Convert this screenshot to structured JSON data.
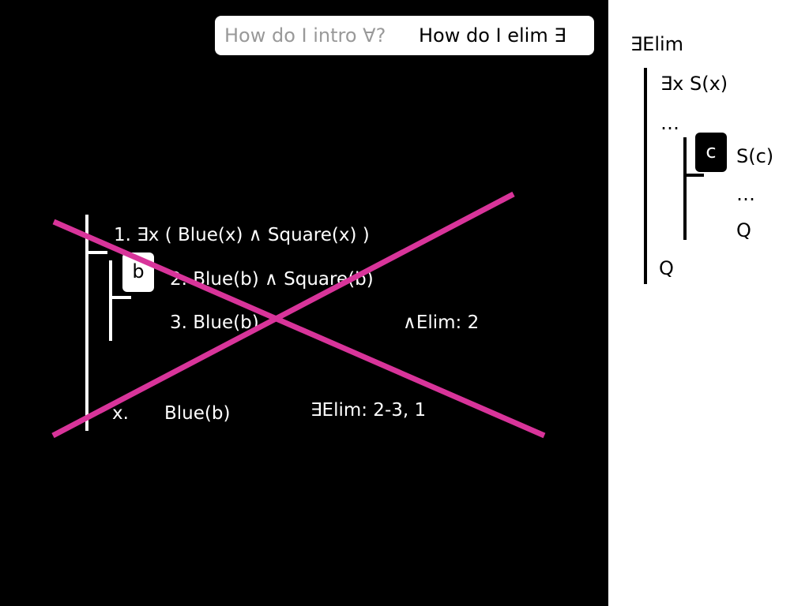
{
  "topbar": {
    "intro_question": "How do I intro ∀?",
    "elim_question": "How do I elim ∃"
  },
  "proof": {
    "line1": "1. ∃x ( Blue(x) ∧ Square(x) )",
    "subproof_constant": "b",
    "line2": "2. Blue(b) ∧ Square(b)",
    "line3": "3. Blue(b)",
    "line3_rule": "∧Elim: 2",
    "conclusion_number": "x.",
    "conclusion": "Blue(b)",
    "conclusion_rule": "∃Elim: 2-3, 1"
  },
  "schema": {
    "title": "∃Elim",
    "premise": "∃x S(x)",
    "dots_outer": "…",
    "constant": "c",
    "sub_assumption": "S(c)",
    "dots_inner": "…",
    "sub_conclusion": "Q",
    "conclusion": "Q"
  },
  "colors": {
    "background": "#000000",
    "side_panel": "#ffffff",
    "cross": "#d8349a",
    "muted_text": "#999999"
  }
}
